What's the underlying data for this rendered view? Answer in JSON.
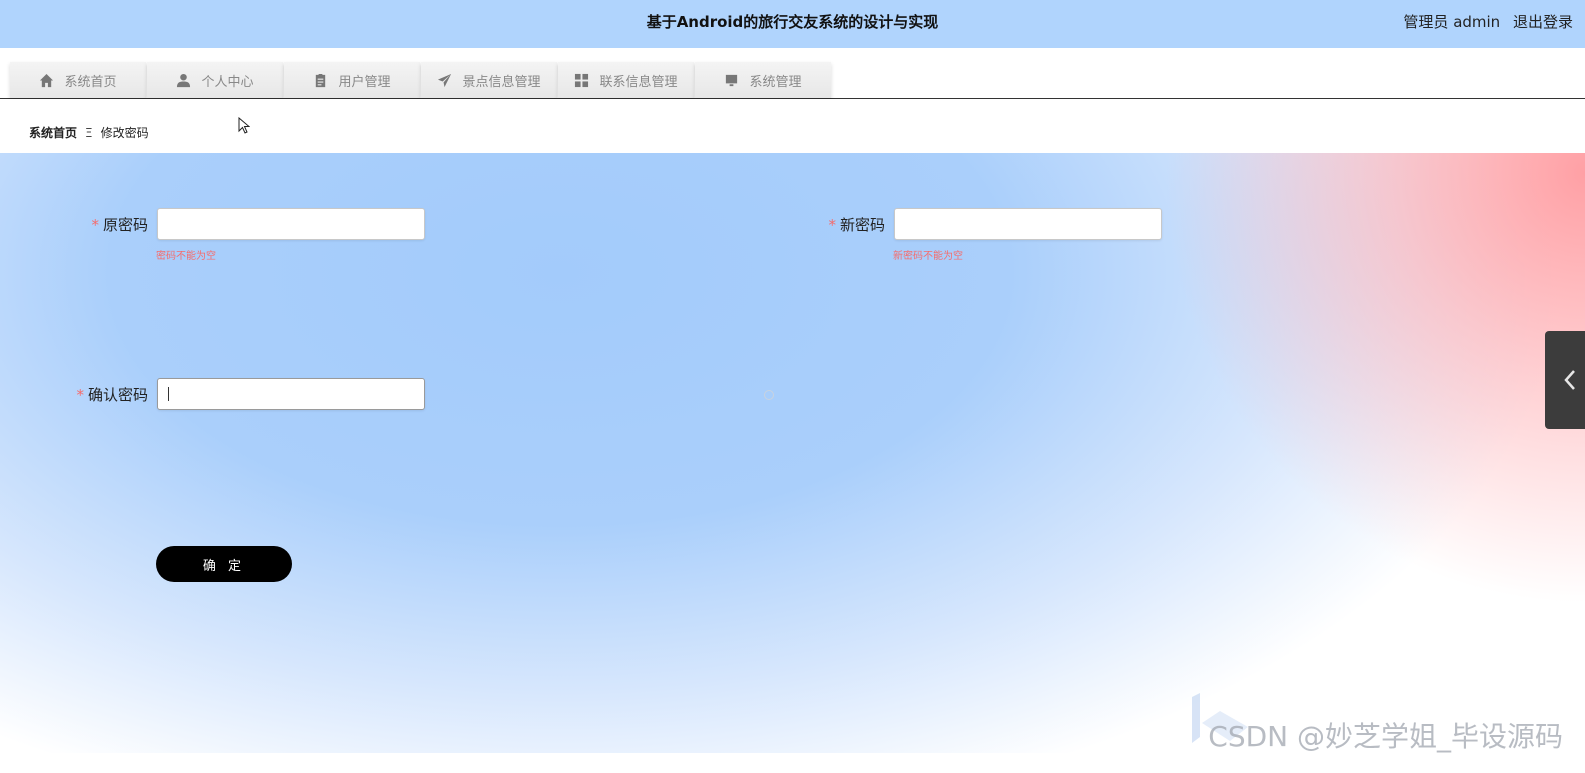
{
  "header": {
    "title": "基于Android的旅行交友系统的设计与实现",
    "user_label": "管理员 admin",
    "logout_label": "退出登录"
  },
  "nav": {
    "tabs": [
      {
        "label": "系统首页",
        "icon": "home-icon"
      },
      {
        "label": "个人中心",
        "icon": "user-icon"
      },
      {
        "label": "用户管理",
        "icon": "clipboard-icon"
      },
      {
        "label": "景点信息管理",
        "icon": "paper-plane-icon"
      },
      {
        "label": "联系信息管理",
        "icon": "grid-icon"
      },
      {
        "label": "系统管理",
        "icon": "monitor-icon"
      }
    ]
  },
  "breadcrumb": {
    "home": "系统首页",
    "separator": "Ξ",
    "current": "修改密码"
  },
  "form": {
    "required_mark": "*",
    "old_password": {
      "label": "原密码",
      "value": "",
      "error": "密码不能为空"
    },
    "new_password": {
      "label": "新密码",
      "value": "",
      "error": "新密码不能为空"
    },
    "confirm_password": {
      "label": "确认密码",
      "value": ""
    },
    "submit_label": "确 定"
  },
  "watermark": "CSDN @妙芝学姐_毕设源码",
  "colors": {
    "header_bg": "#b0d4fd",
    "error": "#f56c6c",
    "button_bg": "#000000"
  }
}
